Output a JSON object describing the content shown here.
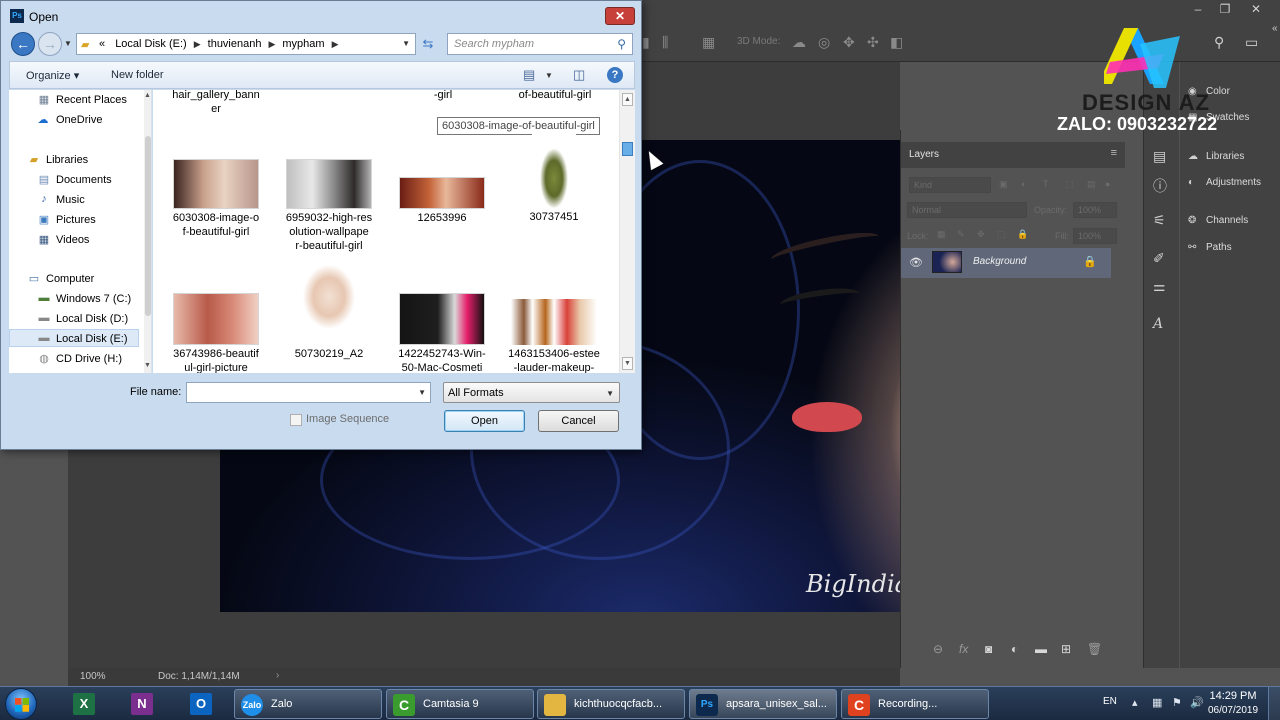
{
  "dialog": {
    "title": "Open",
    "title_icon": "Ps",
    "close_label": "✕",
    "address": {
      "prefix": "«",
      "crumbs": [
        "Local Disk (E:)",
        "thuvienanh",
        "mypham"
      ]
    },
    "search": {
      "placeholder": "Search mypham"
    },
    "toolbar": {
      "organize": "Organize ▾",
      "new_folder": "New folder"
    },
    "nav": {
      "recent_places": "Recent Places",
      "onedrive": "OneDrive",
      "libraries": "Libraries",
      "documents": "Documents",
      "music": "Music",
      "pictures": "Pictures",
      "videos": "Videos",
      "computer": "Computer",
      "windows7": "Windows 7 (C:)",
      "diskd": "Local Disk (D:)",
      "diske": "Local Disk (E:)",
      "cddrive": "CD Drive (H:)"
    },
    "files": {
      "top_cut_1": "hair_gallery_bann\ner",
      "top_cut_2": "-girl",
      "top_cut_3": "of-beautiful-girl",
      "tooltip": "6030308-image-of-beautiful-girl",
      "f1": "6030308-image-o\nf-beautiful-girl",
      "f2": "6959032-high-res\nolution-wallpape\nr-beautiful-girl",
      "f3": "12653996",
      "f4": "30737451",
      "f5": "36743986-beautif\nul-girl-picture",
      "f6": "50730219_A2",
      "f7": "1422452743-Win-\n50-Mac-Cosmeti",
      "f8": "1463153406-estee\n-lauder-makeup-"
    },
    "file_name_label": "File name:",
    "file_name_value": "",
    "format": "All Formats",
    "image_sequence": "Image Sequence",
    "open_button": "Open",
    "cancel_button": "Cancel"
  },
  "photoshop": {
    "options_3d": "3D Mode:",
    "zoom": "100%",
    "doc": "Doc: 1,14M/1,14M",
    "signature": "BigIndian",
    "layers": {
      "tab": "Layers",
      "kind": "Kind",
      "blend": "Normal",
      "opacity": "Opacity:",
      "opacity_val": "100%",
      "lock": "Lock:",
      "fill": "Fill:",
      "fill_val": "100%",
      "layer_name": "Background"
    },
    "panels": {
      "color": "Color",
      "swatches": "Swatches",
      "libraries": "Libraries",
      "adjustments": "Adjustments",
      "channels": "Channels",
      "paths": "Paths"
    }
  },
  "watermark": {
    "brand": "DESIGN AZ",
    "zalo": "ZALO: 0903232722"
  },
  "taskbar": {
    "pins": {
      "excel": "X",
      "onenote": "N",
      "outlook": "O"
    },
    "tasks": {
      "zalo": "Zalo",
      "camtasia": "Camtasia 9",
      "folder": "kichthuocqcfacb...",
      "photoshop": "apsara_unisex_sal...",
      "recording": "Recording..."
    },
    "task_icons": {
      "zalo": "Zalo",
      "photoshop": "Ps",
      "camtasia": "C",
      "recording": "C"
    },
    "lang": "EN",
    "time": "14:29 PM",
    "date": "06/07/2019"
  },
  "colors": {
    "ps_bg": "#535353",
    "dialog_bg": "#c9dbef",
    "taskbar": "#1b2a40",
    "selected_layer": "#5f6778"
  }
}
